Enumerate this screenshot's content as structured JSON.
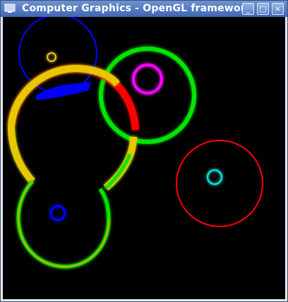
{
  "window": {
    "title": "Computer Graphics - OpenGL framework",
    "buttons": [
      {
        "name": "minimize",
        "glyph": "_"
      },
      {
        "name": "maximize",
        "glyph": "□"
      },
      {
        "name": "close",
        "glyph": "×"
      }
    ]
  },
  "scene": {
    "background": "#000000",
    "colors": {
      "blue": "#0000ff",
      "yellow": "#e6c800",
      "magenta": "#ff00ff",
      "green": "#00e600",
      "red": "#ff0000",
      "cyan": "#00e0e0",
      "orange": "#d9a400"
    }
  }
}
